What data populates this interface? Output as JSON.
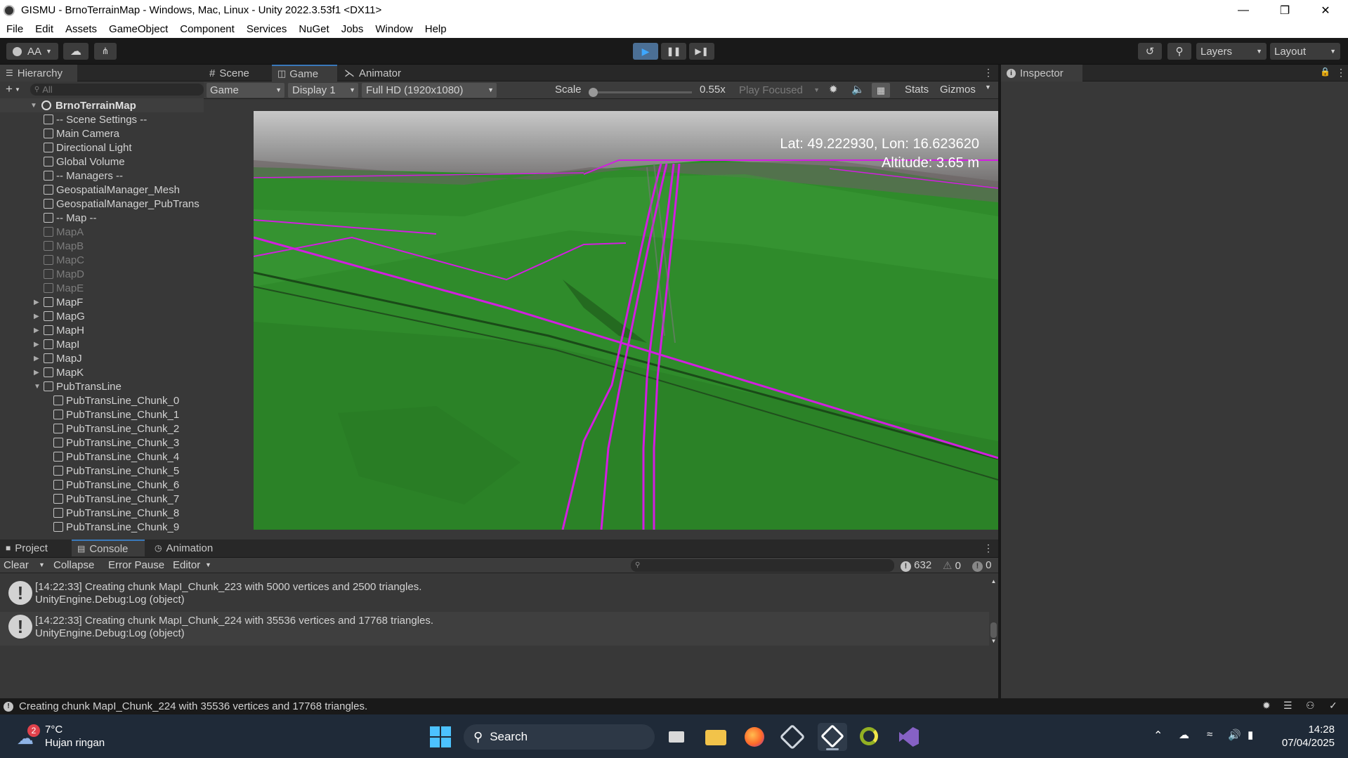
{
  "window": {
    "title": "GISMU - BrnoTerrainMap - Windows, Mac, Linux - Unity 2022.3.53f1 <DX11>",
    "minimize_icon": "minimize-icon",
    "maximize_icon": "restore-icon",
    "close_icon": "close-icon"
  },
  "menu": [
    "File",
    "Edit",
    "Assets",
    "GameObject",
    "Component",
    "Services",
    "NuGet",
    "Jobs",
    "Window",
    "Help"
  ],
  "toolbar": {
    "account_label": "AA",
    "layers_label": "Layers",
    "layout_label": "Layout"
  },
  "hierarchy": {
    "tab_label": "Hierarchy",
    "search_placeholder": "All",
    "scene_name": "BrnoTerrainMap",
    "items": [
      {
        "label": "-- Scene Settings --",
        "dim": false,
        "expandable": false,
        "depth": 1
      },
      {
        "label": "Main Camera",
        "dim": false,
        "expandable": false,
        "depth": 1
      },
      {
        "label": "Directional Light",
        "dim": false,
        "expandable": false,
        "depth": 1
      },
      {
        "label": "Global Volume",
        "dim": false,
        "expandable": false,
        "depth": 1
      },
      {
        "label": "-- Managers --",
        "dim": false,
        "expandable": false,
        "depth": 1
      },
      {
        "label": "GeospatialManager_Mesh",
        "dim": false,
        "expandable": false,
        "depth": 1
      },
      {
        "label": "GeospatialManager_PubTrans",
        "dim": false,
        "expandable": false,
        "depth": 1
      },
      {
        "label": "-- Map --",
        "dim": false,
        "expandable": false,
        "depth": 1
      },
      {
        "label": "MapA",
        "dim": true,
        "expandable": false,
        "depth": 1
      },
      {
        "label": "MapB",
        "dim": true,
        "expandable": false,
        "depth": 1
      },
      {
        "label": "MapC",
        "dim": true,
        "expandable": false,
        "depth": 1
      },
      {
        "label": "MapD",
        "dim": true,
        "expandable": false,
        "depth": 1
      },
      {
        "label": "MapE",
        "dim": true,
        "expandable": false,
        "depth": 1
      },
      {
        "label": "MapF",
        "dim": false,
        "expandable": true,
        "depth": 1
      },
      {
        "label": "MapG",
        "dim": false,
        "expandable": true,
        "depth": 1
      },
      {
        "label": "MapH",
        "dim": false,
        "expandable": true,
        "depth": 1
      },
      {
        "label": "MapI",
        "dim": false,
        "expandable": true,
        "depth": 1
      },
      {
        "label": "MapJ",
        "dim": false,
        "expandable": true,
        "depth": 1
      },
      {
        "label": "MapK",
        "dim": false,
        "expandable": true,
        "depth": 1
      },
      {
        "label": "PubTransLine",
        "dim": false,
        "expandable": true,
        "expanded": true,
        "depth": 1
      },
      {
        "label": "PubTransLine_Chunk_0",
        "dim": false,
        "expandable": false,
        "depth": 2
      },
      {
        "label": "PubTransLine_Chunk_1",
        "dim": false,
        "expandable": false,
        "depth": 2
      },
      {
        "label": "PubTransLine_Chunk_2",
        "dim": false,
        "expandable": false,
        "depth": 2
      },
      {
        "label": "PubTransLine_Chunk_3",
        "dim": false,
        "expandable": false,
        "depth": 2
      },
      {
        "label": "PubTransLine_Chunk_4",
        "dim": false,
        "expandable": false,
        "depth": 2
      },
      {
        "label": "PubTransLine_Chunk_5",
        "dim": false,
        "expandable": false,
        "depth": 2
      },
      {
        "label": "PubTransLine_Chunk_6",
        "dim": false,
        "expandable": false,
        "depth": 2
      },
      {
        "label": "PubTransLine_Chunk_7",
        "dim": false,
        "expandable": false,
        "depth": 2
      },
      {
        "label": "PubTransLine_Chunk_8",
        "dim": false,
        "expandable": false,
        "depth": 2
      },
      {
        "label": "PubTransLine_Chunk_9",
        "dim": false,
        "expandable": false,
        "depth": 2
      }
    ]
  },
  "center_tabs": [
    "Scene",
    "Game",
    "Animator"
  ],
  "game_bar": {
    "mode": "Game",
    "display": "Display 1",
    "resolution": "Full HD (1920x1080)",
    "scale_label": "Scale",
    "scale_value": "0.55x",
    "play_focused": "Play Focused",
    "stats": "Stats",
    "gizmos": "Gizmos"
  },
  "overlay": {
    "coords": "Lat: 49.222930, Lon: 16.623620",
    "altitude": "Altitude: 3.65 m"
  },
  "inspector": {
    "tab_label": "Inspector"
  },
  "bottom_tabs": [
    "Project",
    "Console",
    "Animation"
  ],
  "console": {
    "clear": "Clear",
    "collapse": "Collapse",
    "error_pause": "Error Pause",
    "editor": "Editor",
    "info_count": "632",
    "warn_count": "0",
    "error_count": "0",
    "logs": [
      {
        "line1": "[14:22:33] Creating chunk MapI_Chunk_223 with 5000 vertices and 2500 triangles.",
        "line2": "UnityEngine.Debug:Log (object)"
      },
      {
        "line1": "[14:22:33] Creating chunk MapI_Chunk_224 with 35536 vertices and 17768 triangles.",
        "line2": "UnityEngine.Debug:Log (object)"
      }
    ]
  },
  "status": {
    "text": "Creating chunk MapI_Chunk_224 with 35536 vertices and 17768 triangles."
  },
  "taskbar": {
    "weather_temp": "7°C",
    "weather_desc": "Hujan ringan",
    "weather_badge": "2",
    "search_label": "Search",
    "time": "14:28",
    "date": "07/04/2025"
  },
  "colors": {
    "terrain": "#2e8a2a",
    "lines": "#d21ee0",
    "accent": "#3a79bb"
  }
}
